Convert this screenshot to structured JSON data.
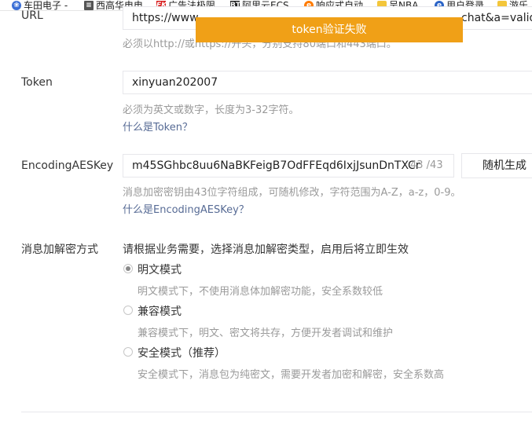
{
  "bookmarks": [
    {
      "label": "车田电子 -",
      "icon": "paw-icon"
    },
    {
      "label": "西高华电电",
      "icon": "document-icon"
    },
    {
      "label": "广告法极限",
      "icon": "fk-icon"
    },
    {
      "label": "阿里云ECS",
      "icon": "bt-icon"
    },
    {
      "label": "响应式自动",
      "icon": "e-icon"
    },
    {
      "label": "吴NBA",
      "icon": "folder-icon"
    },
    {
      "label": "用户登录",
      "icon": "edge-icon"
    },
    {
      "label": "游乐",
      "icon": "folder-icon"
    }
  ],
  "toast": {
    "text": "token验证失败"
  },
  "url": {
    "label": "URL",
    "value": "https://www",
    "value_tail": "chat&a=valid",
    "hint": "必须以http://或https://开头，分别支持80端口和443端口。"
  },
  "token": {
    "label": "Token",
    "value": "xinyuan202007",
    "hint": "必须为英文或数字，长度为3-32字符。",
    "help_link": "什么是Token？"
  },
  "aes": {
    "label": "EncodingAESKey",
    "value": "m45SGhbc8uu6NaBKFeigB7OdFFEqd6IxjJsunDnTXCr",
    "counter": "43 /43",
    "random_button": "随机生成",
    "hint": "消息加密密钥由43位字符组成，可随机修改，字符范围为A-Z，a-z，0-9。",
    "help_link": "什么是EncodingAESKey？"
  },
  "encrypt": {
    "label": "消息加解密方式",
    "intro": "请根据业务需要，选择消息加解密类型，启用后将立即生效",
    "options": [
      {
        "label": "明文模式",
        "desc": "明文模式下，不使用消息体加解密功能，安全系数较低",
        "checked": true
      },
      {
        "label": "兼容模式",
        "desc": "兼容模式下，明文、密文将共存，方便开发者调试和维护",
        "checked": false
      },
      {
        "label": "安全模式（推荐）",
        "desc": "安全模式下，消息包为纯密文，需要开发者加密和解密，安全系数高",
        "checked": false
      }
    ]
  }
}
